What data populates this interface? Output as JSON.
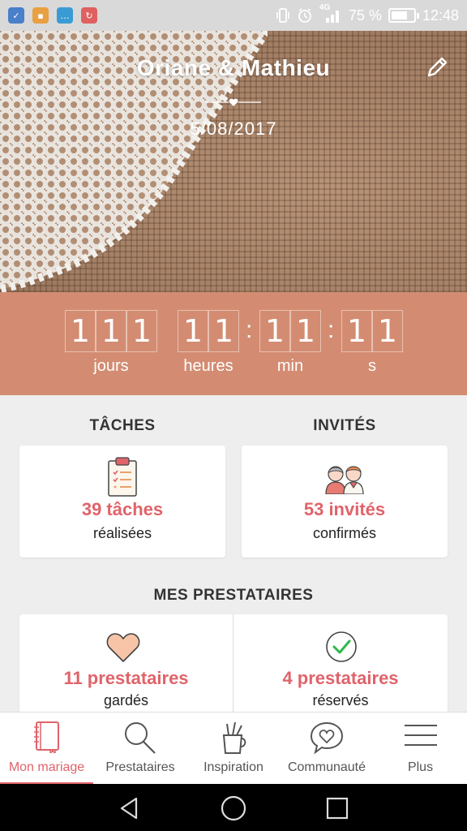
{
  "status_bar": {
    "signal_label": "4G",
    "battery_percent": "75 %",
    "battery_level": 0.75,
    "time": "12:48",
    "notification_icons": [
      "app-icon-blue",
      "app-icon-orange",
      "message-icon",
      "app-icon-red"
    ]
  },
  "hero": {
    "couple_names": "Oriane & Mathieu",
    "wedding_date": "5/08/2017"
  },
  "countdown": {
    "days_digits": [
      "1",
      "1",
      "1"
    ],
    "hours_digits": [
      "1",
      "1"
    ],
    "minutes_digits": [
      "1",
      "1"
    ],
    "seconds_digits": [
      "1",
      "1"
    ],
    "days_label": "jours",
    "hours_label": "heures",
    "minutes_label": "min",
    "seconds_label": "s",
    "separator": ":"
  },
  "tasks": {
    "title": "TÂCHES",
    "count": "39 tâches",
    "subtitle": "réalisées",
    "icon": "clipboard-icon"
  },
  "guests": {
    "title": "INVITÉS",
    "count": "53 invités",
    "subtitle": "confirmés",
    "icon": "couple-icon"
  },
  "vendors": {
    "title": "MES PRESTATAIRES",
    "kept_count": "11 prestataires",
    "kept_subtitle": "gardés",
    "booked_count": "4 prestataires",
    "booked_subtitle": "réservés"
  },
  "bottom_nav": [
    {
      "label": "Mon mariage",
      "icon": "notebook-icon",
      "active": true
    },
    {
      "label": "Prestataires",
      "icon": "search-icon",
      "active": false
    },
    {
      "label": "Inspiration",
      "icon": "pencil-cup-icon",
      "active": false
    },
    {
      "label": "Communauté",
      "icon": "heart-chat-icon",
      "active": false
    },
    {
      "label": "Plus",
      "icon": "menu-icon",
      "active": false
    }
  ],
  "colors": {
    "accent": "#e0636a",
    "countdown_bg": "#d38c72",
    "heart_fill": "#f7c4a8",
    "check_green": "#2db84d"
  }
}
